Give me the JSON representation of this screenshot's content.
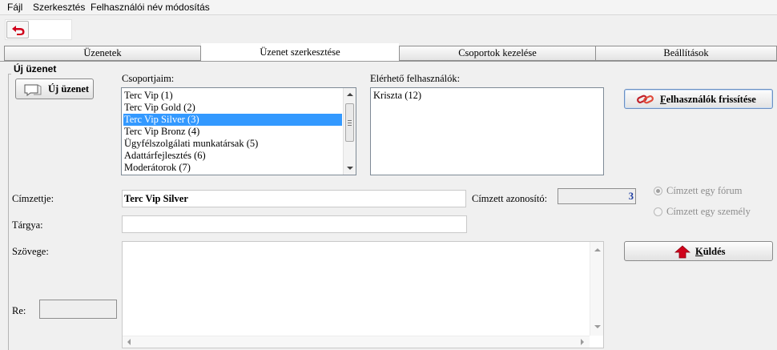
{
  "menu": {
    "file": "Fájl",
    "edit": "Szerkesztés",
    "rename": "Felhasználói név módosítás"
  },
  "tabs": [
    {
      "label": "Üzenetek"
    },
    {
      "label": "Üzenet szerkesztése"
    },
    {
      "label": "Csoportok kezelése"
    },
    {
      "label": "Beállítások"
    }
  ],
  "section": {
    "title": "Új üzenet"
  },
  "new_message_button": "Új üzenet",
  "groups": {
    "label": "Csoportjaim:",
    "items": [
      "Terc Vip (1)",
      "Terc Vip Gold (2)",
      "Terc Vip Silver (3)",
      "Terc Vip Bronz (4)",
      "Ügyfélszolgálati munkatársak (5)",
      "Adattárfejlesztés (6)",
      "Moderátorok (7)"
    ],
    "selected_index": 2
  },
  "users": {
    "label": "Elérhető felhasználók:",
    "items": [
      "Kriszta (12)"
    ]
  },
  "refresh_button": {
    "accel": "F",
    "rest": "elhasználók frissítése"
  },
  "recipient": {
    "label": "Címzettje:",
    "value": "Terc Vip Silver"
  },
  "recipient_id": {
    "label": "Címzett azonosító:",
    "value": "3"
  },
  "radios": {
    "forum": "Címzett egy fórum",
    "person": "Címzett egy személy"
  },
  "subject": {
    "label": "Tárgya:",
    "value": ""
  },
  "body": {
    "label": "Szövege:",
    "value": ""
  },
  "re": {
    "label": "Re:",
    "value": ""
  },
  "send_button": {
    "accel": "K",
    "rest": "üldés"
  },
  "colors": {
    "selection": "#3399ff",
    "id_value": "#1a3aa0",
    "back_icon": "#d0021b",
    "send_icon": "#d0021b"
  }
}
